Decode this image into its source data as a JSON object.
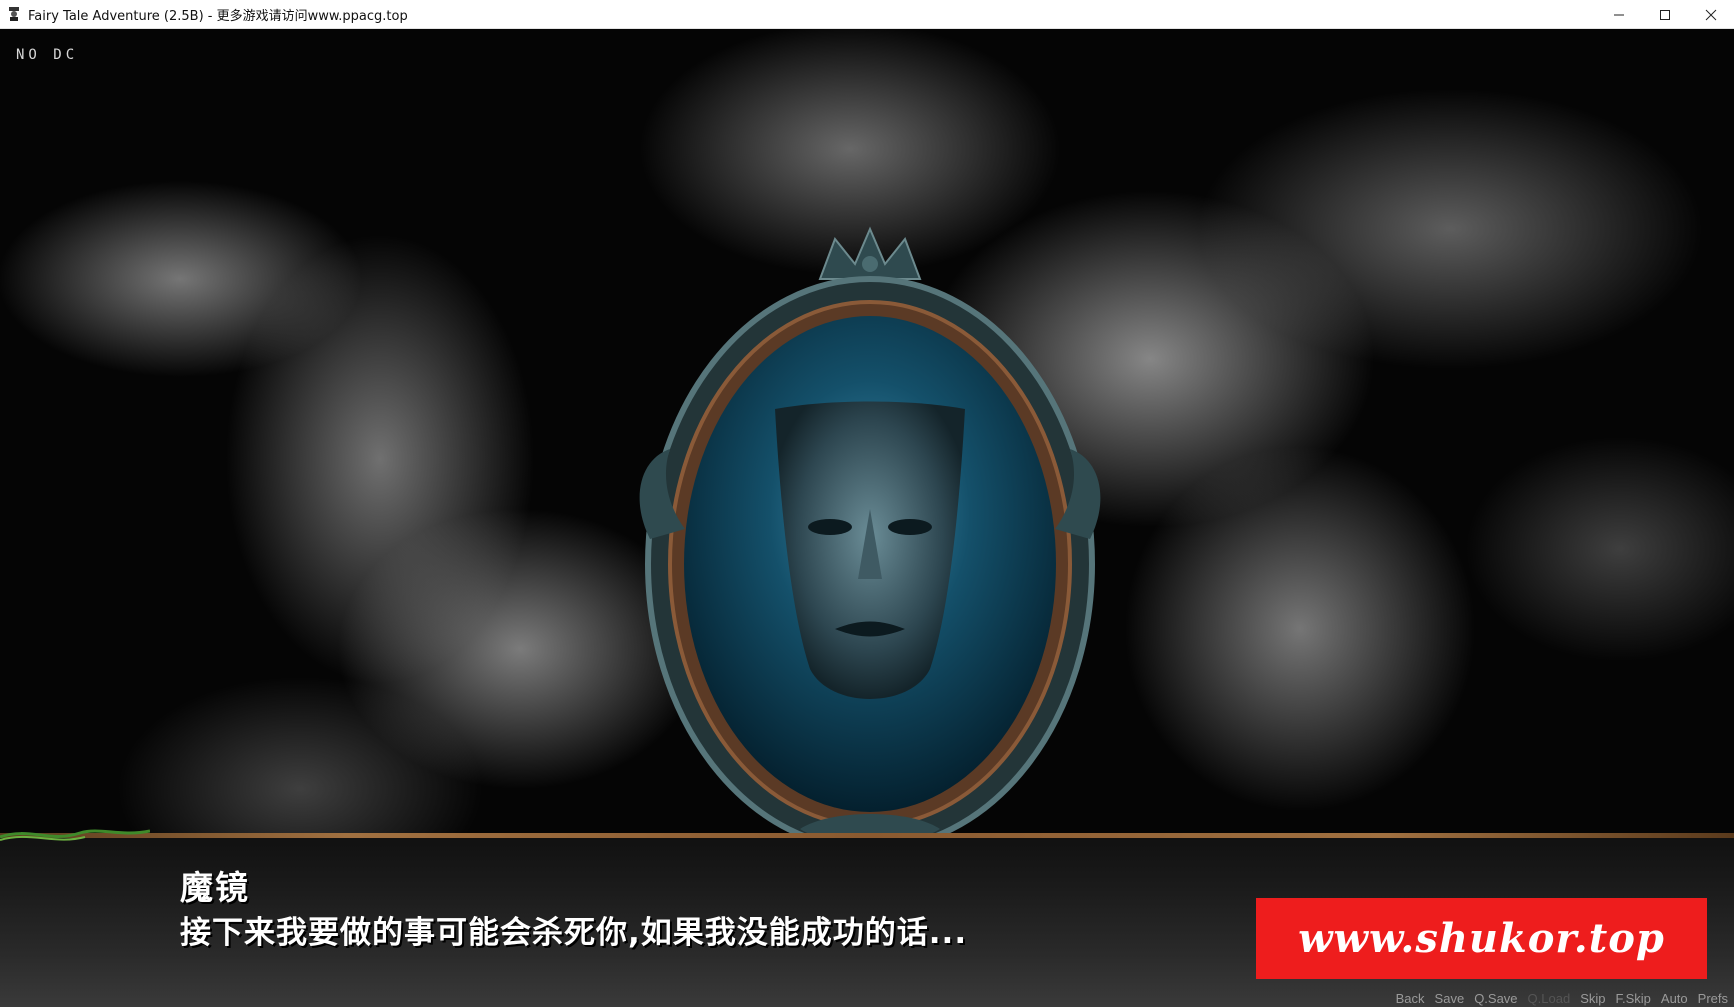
{
  "window": {
    "title": "Fairy Tale Adventure (2.5B) - 更多游戏请访问www.ppacg.top",
    "controls": {
      "minimize": "minimize-icon",
      "maximize": "maximize-icon",
      "close": "close-icon"
    }
  },
  "hud": {
    "corner_label": "NO DC"
  },
  "dialogue": {
    "speaker": "魔镜",
    "text": "接下来我要做的事可能会杀死你,如果我没能成功的话..."
  },
  "watermark": {
    "text": "www.shukor.top"
  },
  "quick_menu": [
    {
      "label": "Back",
      "enabled": true
    },
    {
      "label": "Save",
      "enabled": true
    },
    {
      "label": "Q.Save",
      "enabled": true
    },
    {
      "label": "Q.Load",
      "enabled": false
    },
    {
      "label": "Skip",
      "enabled": true
    },
    {
      "label": "F.Skip",
      "enabled": true
    },
    {
      "label": "Auto",
      "enabled": true
    },
    {
      "label": "Prefs",
      "enabled": true
    }
  ],
  "colors": {
    "watermark_bg": "#ee1d1d",
    "frame_border": "#a07040"
  }
}
